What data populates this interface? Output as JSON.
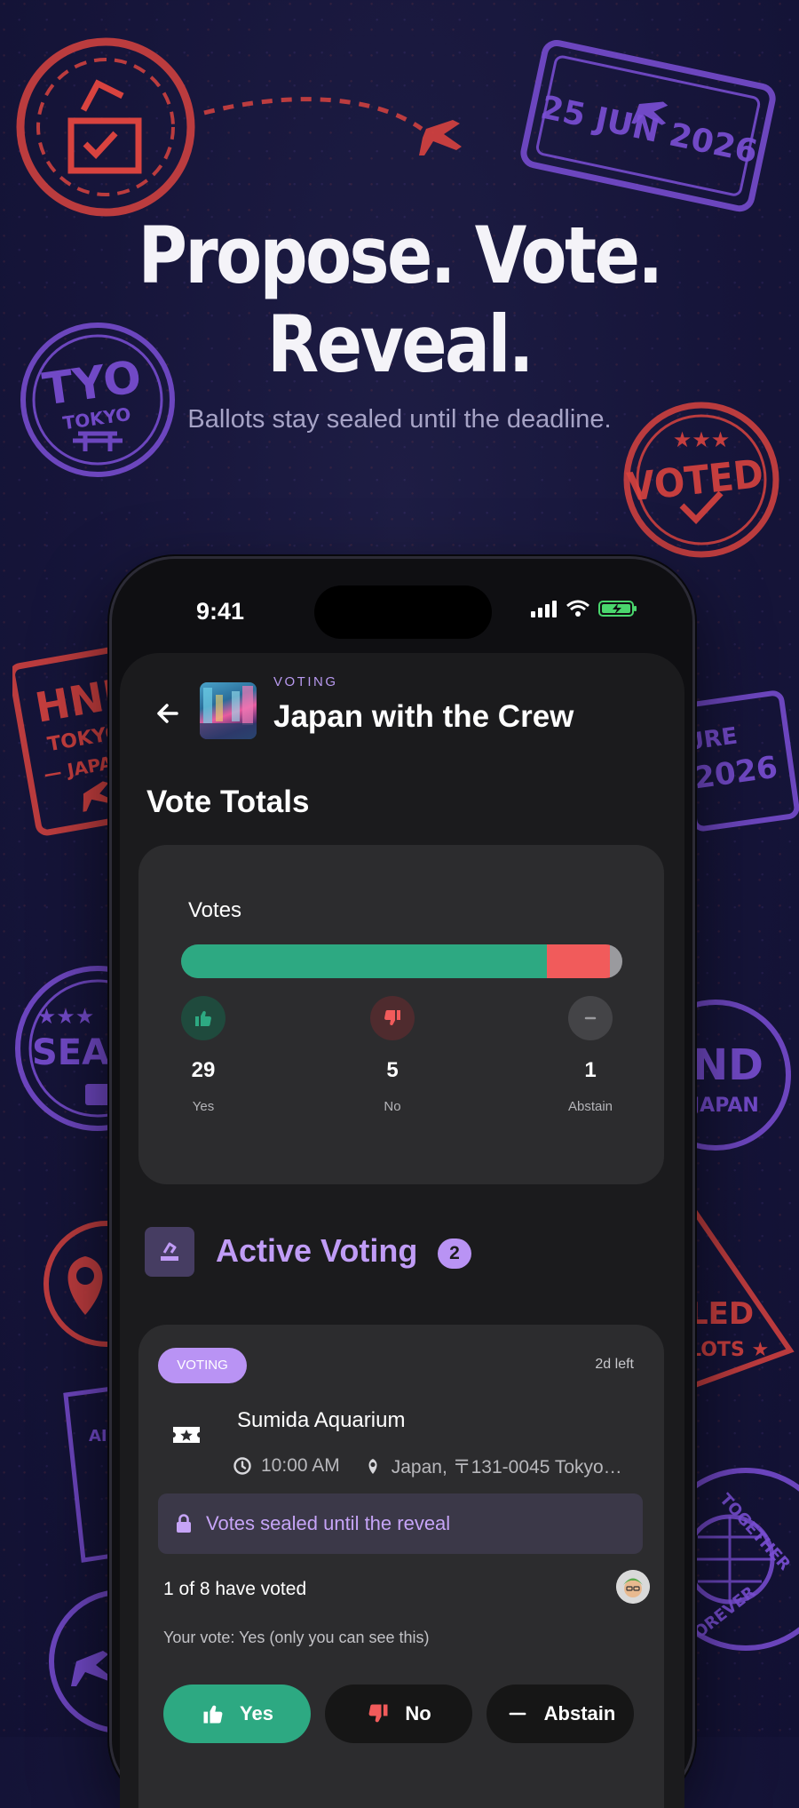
{
  "hero": {
    "title_line1": "Propose. Vote.",
    "title_line2": "Reveal.",
    "subtitle": "Ballots stay sealed until the deadline."
  },
  "stamps": {
    "date_stamp": "25 JUN 2026",
    "tyo_big": "TYO",
    "tyo_small": "TOKYO",
    "voted": "VOTED",
    "hnd_big": "HND",
    "hnd_city": "TOKYO",
    "hnd_country": "— JAPAN",
    "departure_partial": "URE",
    "departure_year": "2026",
    "sealed_partial": "SEAL",
    "nd_partial": "ND",
    "japan_partial": "JAPAN",
    "sealed_ballots_1": "LED",
    "sealed_ballots_2": "LOTS ★",
    "together": "TOGETHER",
    "forever": "FOREVER",
    "al_partial": "AI"
  },
  "status_bar": {
    "time": "9:41"
  },
  "trip": {
    "eyebrow": "VOTING",
    "title": "Japan with the Crew"
  },
  "totals": {
    "section_title": "Vote Totals",
    "card_label": "Votes",
    "yes_count": "29",
    "yes_label": "Yes",
    "yes_color": "#2da982",
    "no_count": "5",
    "no_label": "No",
    "no_color": "#f15b5b",
    "abstain_count": "1",
    "abstain_label": "Abstain",
    "abstain_color": "#9a9a9e"
  },
  "active": {
    "title": "Active Voting",
    "count": "2"
  },
  "item": {
    "status_chip": "VOTING",
    "time_left": "2d left",
    "name": "Sumida Aquarium",
    "time": "10:00 AM",
    "location": "Japan, 〒131-0045 Tokyo…",
    "sealed_notice": "Votes sealed until the reveal",
    "voted_count": "1 of 8 have voted",
    "your_vote": "Your vote: Yes (only you can see this)",
    "btn_yes": "Yes",
    "btn_no": "No",
    "btn_abstain": "Abstain"
  },
  "colors": {
    "accent_purple": "#b993f4",
    "stamp_red": "#e04848",
    "stamp_purple": "#7b4fd6"
  }
}
